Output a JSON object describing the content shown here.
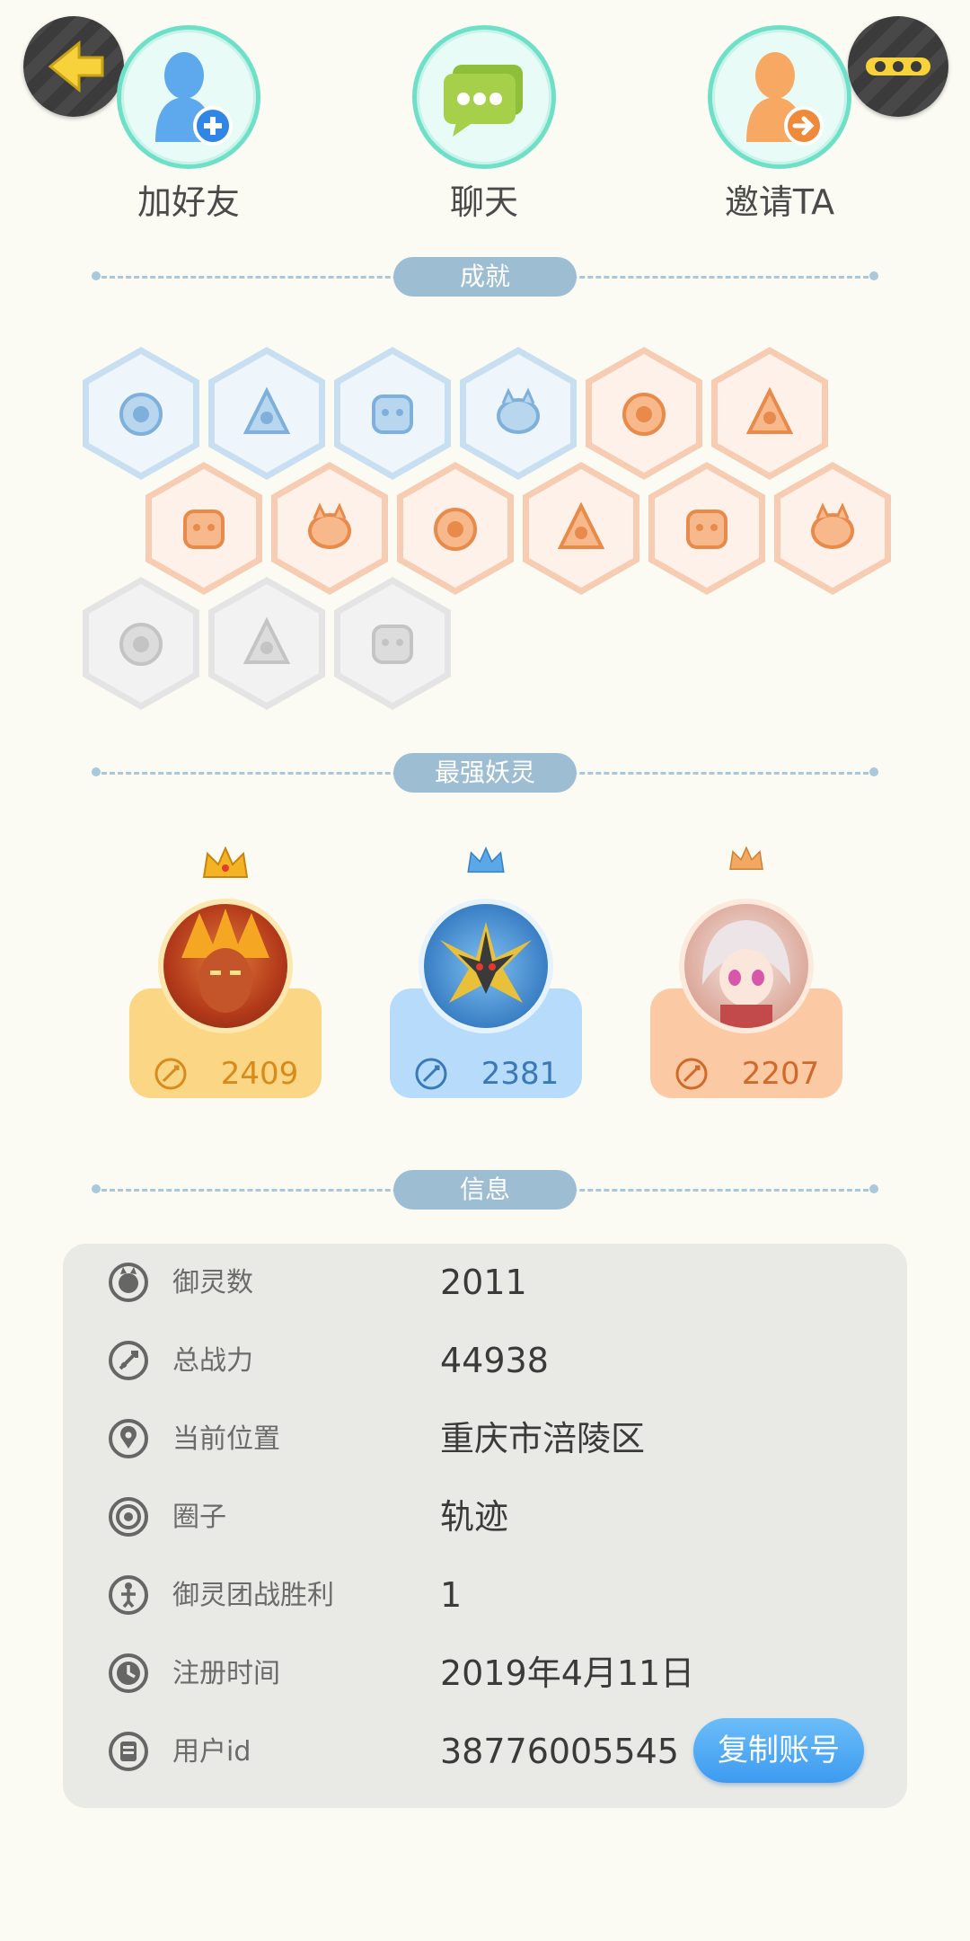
{
  "header": {
    "back_icon": "back-arrow-icon",
    "more_icon": "more-dots-icon",
    "accent_yellow": "#f7d23a"
  },
  "actions": [
    {
      "label": "加好友",
      "icon": "add-friend-icon"
    },
    {
      "label": "聊天",
      "icon": "chat-icon"
    },
    {
      "label": "邀请TA",
      "icon": "invite-icon"
    }
  ],
  "sections": {
    "achievements": "成就",
    "strongest": "最强妖灵",
    "info": "信息"
  },
  "achievements": [
    {
      "icon": "sneaker-icon",
      "state": "blue"
    },
    {
      "icon": "cat-face-icon",
      "state": "blue"
    },
    {
      "icon": "spirit-balloon-icon",
      "state": "blue"
    },
    {
      "icon": "taiji-pouch-icon",
      "state": "blue"
    },
    {
      "icon": "target-sign-icon",
      "state": "orange"
    },
    {
      "icon": "moon-icon",
      "state": "orange"
    },
    {
      "icon": "mushroom-icon",
      "state": "orange"
    },
    {
      "icon": "crystal-egg-icon",
      "state": "orange"
    },
    {
      "icon": "taiji-wave-icon",
      "state": "orange"
    },
    {
      "icon": "flame-spirit-icon",
      "state": "orange"
    },
    {
      "icon": "koi-fish-icon",
      "state": "orange"
    },
    {
      "icon": "scroll-shield-icon",
      "state": "orange"
    },
    {
      "icon": "cart-cat-icon",
      "state": "gray"
    },
    {
      "icon": "horned-statue-icon",
      "state": "gray"
    },
    {
      "icon": "book-cat-icon",
      "state": "gray"
    }
  ],
  "strongest": [
    {
      "power": "2409",
      "theme": "gold",
      "portrait": "fire-warrior-portrait"
    },
    {
      "power": "2381",
      "theme": "blue",
      "portrait": "crystal-beast-portrait"
    },
    {
      "power": "2207",
      "theme": "orange",
      "portrait": "white-hair-girl-portrait"
    }
  ],
  "info": {
    "rows": [
      {
        "label": "御灵数",
        "value": "2011",
        "icon": "spirit-count-icon"
      },
      {
        "label": "总战力",
        "value": "44938",
        "icon": "power-sword-icon"
      },
      {
        "label": "当前位置",
        "value": "重庆市涪陵区",
        "icon": "location-pin-icon"
      },
      {
        "label": "圈子",
        "value": "轨迹",
        "icon": "circle-target-icon"
      },
      {
        "label": "御灵团战胜利",
        "value": "1",
        "icon": "trophy-figure-icon"
      },
      {
        "label": "注册时间",
        "value": "2019年4月11日",
        "icon": "clock-icon"
      },
      {
        "label": "用户id",
        "value": "38776005545",
        "icon": "id-card-icon"
      }
    ],
    "copy_button": "复制账号"
  }
}
